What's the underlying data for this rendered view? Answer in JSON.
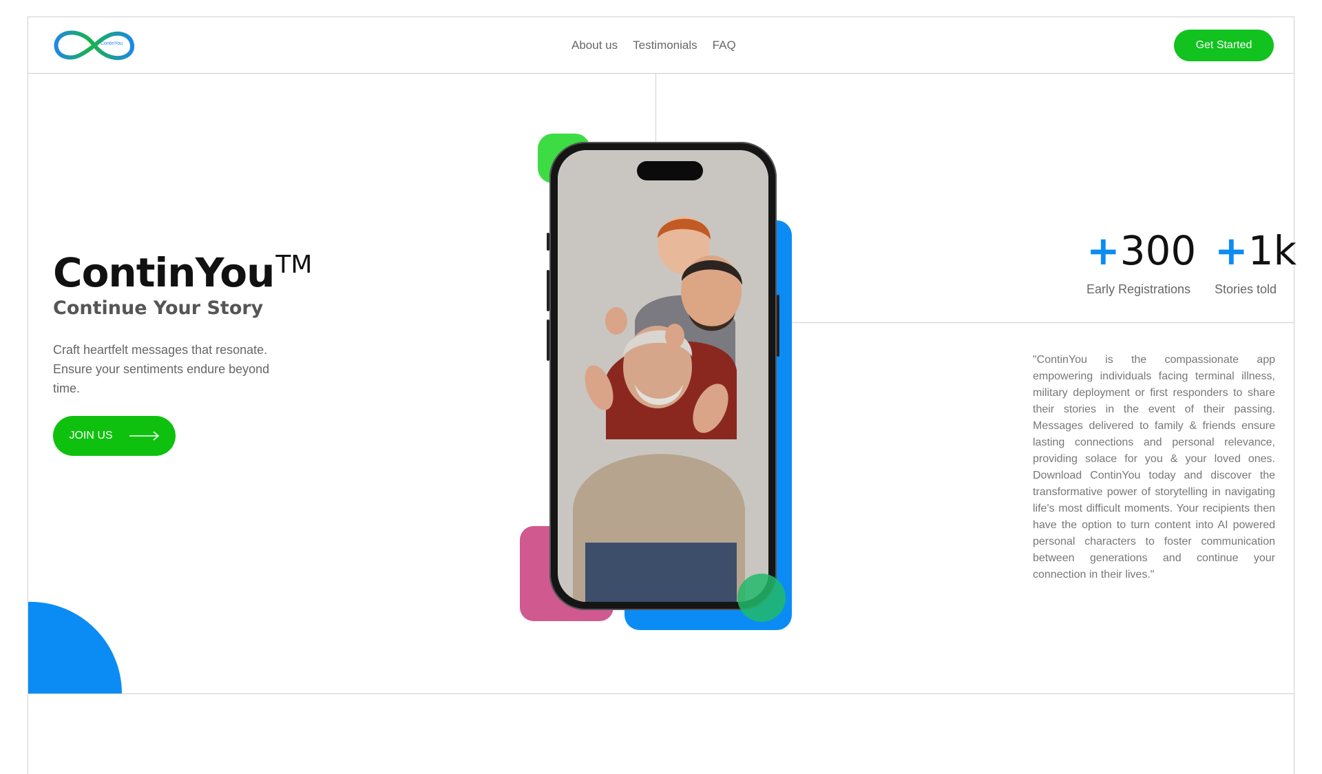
{
  "brand": {
    "logo_text": "ContinYou",
    "name": "ContinYou",
    "trademark": "TM",
    "tagline": "Continue Your Story",
    "lead": "Craft heartfelt messages that resonate. Ensure your sentiments endure beyond time."
  },
  "nav": {
    "items": [
      "About us",
      "Testimonials",
      "FAQ"
    ]
  },
  "header": {
    "cta_label": "Get Started"
  },
  "hero": {
    "join_label": "JOIN US"
  },
  "stats": [
    {
      "plus": "+",
      "value": "300",
      "label": "Early Registrations"
    },
    {
      "plus": "+",
      "value": "1k",
      "label": "Stories told"
    }
  ],
  "quote": "\"ContinYou is the compassionate app empowering individuals facing terminal illness, military deployment or first responders to share their stories in the event of their passing. Messages delivered to family & friends ensure lasting connections and personal relevance, providing solace for you & your loved ones. Download ContinYou today and discover the transformative power of storytelling in navigating life's most difficult moments. Your recipients then have the option to turn content into AI powered personal characters to foster communication between generations and continue your connection in their lives.\"",
  "colors": {
    "accent_green": "#12c21f",
    "accent_blue": "#0b8cf5",
    "accent_pink": "#d05a8f"
  },
  "icons": {
    "logo": "infinity-logo-icon",
    "join_arrow": "arrow-right-icon",
    "phone_photo": "family-photo-illustration"
  }
}
